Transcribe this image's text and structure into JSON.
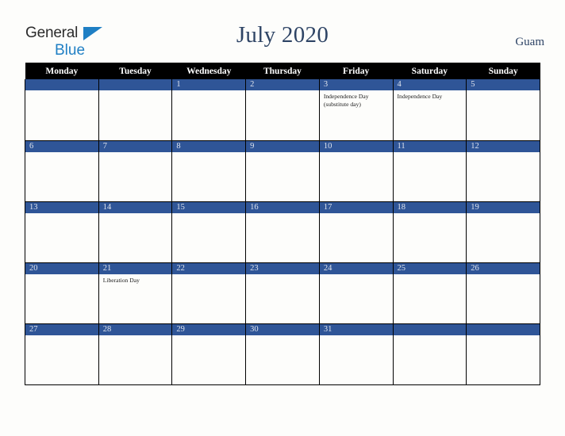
{
  "brand": {
    "word1": "General",
    "word2": "Blue",
    "triangle_color": "#1f7fc4",
    "word1_color": "#2b2b2b",
    "word2_color": "#1f7fc4"
  },
  "header": {
    "title": "July 2020",
    "country": "Guam",
    "title_color": "#2e4465"
  },
  "theme": {
    "header_row_bg": "#000000",
    "header_row_text": "#ffffff",
    "day_bar_bg": "#2f5597",
    "day_bar_text": "#dfe4ee",
    "page_bg": "#fdfdfb",
    "grid_line": "#000000"
  },
  "weekdays": [
    "Monday",
    "Tuesday",
    "Wednesday",
    "Thursday",
    "Friday",
    "Saturday",
    "Sunday"
  ],
  "weeks": [
    [
      {
        "day": "",
        "events": []
      },
      {
        "day": "",
        "events": []
      },
      {
        "day": "1",
        "events": []
      },
      {
        "day": "2",
        "events": []
      },
      {
        "day": "3",
        "events": [
          "Independence Day (substitute day)"
        ]
      },
      {
        "day": "4",
        "events": [
          "Independence Day"
        ]
      },
      {
        "day": "5",
        "events": []
      }
    ],
    [
      {
        "day": "6",
        "events": []
      },
      {
        "day": "7",
        "events": []
      },
      {
        "day": "8",
        "events": []
      },
      {
        "day": "9",
        "events": []
      },
      {
        "day": "10",
        "events": []
      },
      {
        "day": "11",
        "events": []
      },
      {
        "day": "12",
        "events": []
      }
    ],
    [
      {
        "day": "13",
        "events": []
      },
      {
        "day": "14",
        "events": []
      },
      {
        "day": "15",
        "events": []
      },
      {
        "day": "16",
        "events": []
      },
      {
        "day": "17",
        "events": []
      },
      {
        "day": "18",
        "events": []
      },
      {
        "day": "19",
        "events": []
      }
    ],
    [
      {
        "day": "20",
        "events": []
      },
      {
        "day": "21",
        "events": [
          "Liberation Day"
        ]
      },
      {
        "day": "22",
        "events": []
      },
      {
        "day": "23",
        "events": []
      },
      {
        "day": "24",
        "events": []
      },
      {
        "day": "25",
        "events": []
      },
      {
        "day": "26",
        "events": []
      }
    ],
    [
      {
        "day": "27",
        "events": []
      },
      {
        "day": "28",
        "events": []
      },
      {
        "day": "29",
        "events": []
      },
      {
        "day": "30",
        "events": []
      },
      {
        "day": "31",
        "events": []
      },
      {
        "day": "",
        "events": []
      },
      {
        "day": "",
        "events": []
      }
    ]
  ]
}
